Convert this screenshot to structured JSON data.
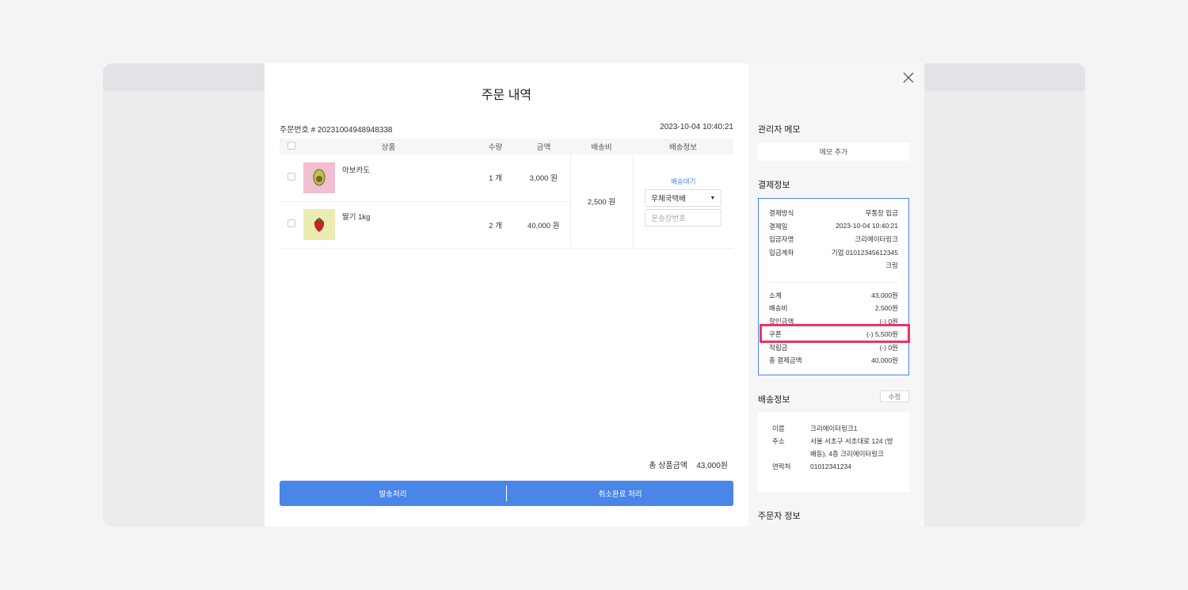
{
  "modal": {
    "title": "주문 내역",
    "order_number": "주문번호 # 20231004948948338",
    "order_datetime": "2023-10-04 10:40:21"
  },
  "table": {
    "headers": [
      "상품",
      "수량",
      "금액",
      "배송비",
      "배송정보"
    ],
    "items": [
      {
        "name": "아보카도",
        "qty": "1 개",
        "price": "3,000 원",
        "image": "avocado"
      },
      {
        "name": "딸기 1kg",
        "qty": "2 개",
        "price": "40,000 원",
        "image": "strawberry"
      }
    ],
    "shipping_fee": "2,500 원",
    "shipping_status": "배송대기",
    "courier": "우체국택배",
    "tracking_placeholder": "운송장번호"
  },
  "total_label": "총 상품금액",
  "total_value": "43,000원",
  "buttons": {
    "ship": "발송처리",
    "cancel": "취소완료 처리"
  },
  "side": {
    "memo_title": "관리자 메모",
    "memo_add": "메모 추가",
    "payment_title": "결제정보",
    "payment": [
      {
        "k": "결제방식",
        "v": "무통장 입금"
      },
      {
        "k": "결제일",
        "v": "2023-10-04 10:40:21"
      },
      {
        "k": "입금자명",
        "v": "크리에이터링크"
      },
      {
        "k": "입금계좌",
        "v": "기업 01012345612345"
      },
      {
        "k": "",
        "v": "크링"
      }
    ],
    "amounts": [
      {
        "k": "소계",
        "v": "43,000원"
      },
      {
        "k": "배송비",
        "v": "2,500원"
      },
      {
        "k": "할인금액",
        "v": "(-) 0원"
      },
      {
        "k": "쿠폰",
        "v": "(-) 5,500원"
      },
      {
        "k": "적립금",
        "v": "(-) 0원"
      },
      {
        "k": "총 결제금액",
        "v": "40,000원"
      }
    ],
    "shipping_title": "배송정보",
    "edit": "수정",
    "shipping": [
      {
        "k": "이름",
        "v": "크리에이터링크1"
      },
      {
        "k": "주소",
        "v": "서울 서초구 서초대로 124 (방배동), 4층 크리에이터링크"
      },
      {
        "k": "연락처",
        "v": "01012341234"
      }
    ],
    "orderer_title": "주문자 정보"
  },
  "colors": {
    "accent": "#4a86e8",
    "highlight": "#f0306a"
  }
}
